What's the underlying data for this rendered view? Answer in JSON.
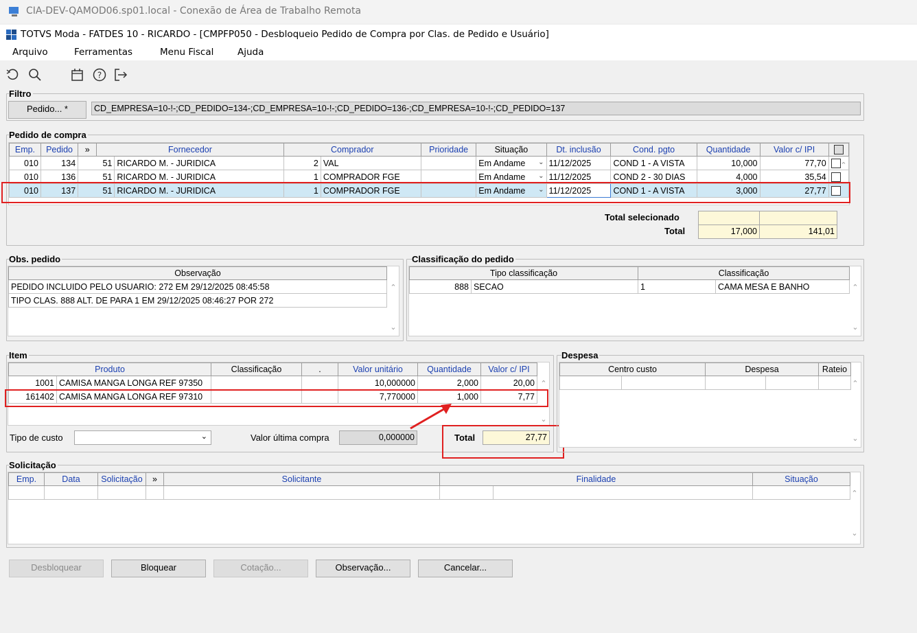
{
  "window": {
    "rdp_title": "CIA-DEV-QAMOD06.sp01.local - Conexão de Área de Trabalho Remota",
    "app_title": "TOTVS Moda - FATDES 10 - RICARDO - [CMPFP050 - Desbloqueio Pedido de Compra por Clas. de Pedido e Usuário]"
  },
  "menu": [
    "Arquivo",
    "Ferramentas",
    "Menu Fiscal",
    "Ajuda"
  ],
  "toolbar": {
    "icons": [
      "undo-icon",
      "search-icon",
      "calendar-icon",
      "help-icon",
      "exit-icon"
    ]
  },
  "filtro": {
    "label": "Filtro",
    "button": "Pedido... *",
    "value": "CD_EMPRESA=10-!-;CD_PEDIDO=134-;CD_EMPRESA=10-!-;CD_PEDIDO=136-;CD_EMPRESA=10-!-;CD_PEDIDO=137"
  },
  "pedido": {
    "label": "Pedido de compra",
    "headers": [
      "Emp.",
      "Pedido",
      "»",
      "Fornecedor",
      "Comprador",
      "Prioridade",
      "Situação",
      "Dt. inclusão",
      "Cond. pgto",
      "Quantidade",
      "Valor c/ IPI"
    ],
    "rows": [
      {
        "emp": "010",
        "pedido": "134",
        "forn_cod": "51",
        "forn": "RICARDO M. - JURIDICA",
        "comp_cod": "2",
        "comp": "VAL",
        "prior": "",
        "sit": "Em Andame",
        "dt": "11/12/2025",
        "cond": "COND 1 - A VISTA",
        "qtd": "10,000",
        "valor": "77,70"
      },
      {
        "emp": "010",
        "pedido": "136",
        "forn_cod": "51",
        "forn": "RICARDO M. - JURIDICA",
        "comp_cod": "1",
        "comp": "COMPRADOR FGE",
        "prior": "",
        "sit": "Em Andame",
        "dt": "11/12/2025",
        "cond": "COND 2 - 30 DIAS",
        "qtd": "4,000",
        "valor": "35,54"
      },
      {
        "emp": "010",
        "pedido": "137",
        "forn_cod": "51",
        "forn": "RICARDO M. - JURIDICA",
        "comp_cod": "1",
        "comp": "COMPRADOR FGE",
        "prior": "",
        "sit": "Em Andame",
        "dt": "11/12/2025",
        "cond": "COND 1 - A VISTA",
        "qtd": "3,000",
        "valor": "27,77"
      }
    ],
    "total_sel_label": "Total selecionado",
    "total_label": "Total",
    "total_sel_qtd": "",
    "total_sel_valor": "",
    "total_qtd": "17,000",
    "total_valor": "141,01"
  },
  "obs": {
    "label": "Obs. pedido",
    "header": "Observação",
    "rows": [
      "PEDIDO INCLUIDO PELO USUARIO: 272 EM 29/12/2025 08:45:58",
      "TIPO CLAS. 888 ALT. DE  PARA 1 EM 29/12/2025 08:46:27 POR 272"
    ]
  },
  "classif": {
    "label": "Classificação do pedido",
    "headers": [
      "Tipo classificação",
      "Classificação"
    ],
    "rows": [
      {
        "tipo_cod": "888",
        "tipo": "SECAO",
        "cls_cod": "1",
        "cls": "CAMA MESA E BANHO"
      }
    ]
  },
  "item": {
    "label": "Item",
    "headers": [
      "Produto",
      "Classificação",
      ".",
      "Valor unitário",
      "Quantidade",
      "Valor c/ IPI"
    ],
    "rows": [
      {
        "cod": "1001",
        "prod": "CAMISA MANGA LONGA REF 97350",
        "cls": "",
        "dot": "",
        "vu": "10,000000",
        "qtd": "2,000",
        "valor": "20,00"
      },
      {
        "cod": "161402",
        "prod": "CAMISA MANGA LONGA REF 97310",
        "cls": "",
        "dot": "",
        "vu": "7,770000",
        "qtd": "1,000",
        "valor": "7,77"
      }
    ],
    "tipo_custo_label": "Tipo de custo",
    "tipo_custo_value": "",
    "ultima_label": "Valor última compra",
    "ultima_value": "0,000000",
    "total_label": "Total",
    "total_value": "27,77"
  },
  "despesa": {
    "label": "Despesa",
    "headers": [
      "Centro custo",
      "Despesa",
      "Rateio"
    ]
  },
  "solic": {
    "label": "Solicitação",
    "headers": [
      "Emp.",
      "Data",
      "Solicitação",
      "»",
      "Solicitante",
      "Finalidade",
      "Situação"
    ]
  },
  "buttons": {
    "desbloquear": "Desbloquear",
    "bloquear": "Bloquear",
    "cotacao": "Cotação...",
    "observacao": "Observação...",
    "cancelar": "Cancelar..."
  },
  "colors": {
    "annotation": "#e02020",
    "selected_row": "#cfe8f5",
    "total_bg": "#fdf8d9",
    "header_text": "#1a3fb0"
  }
}
